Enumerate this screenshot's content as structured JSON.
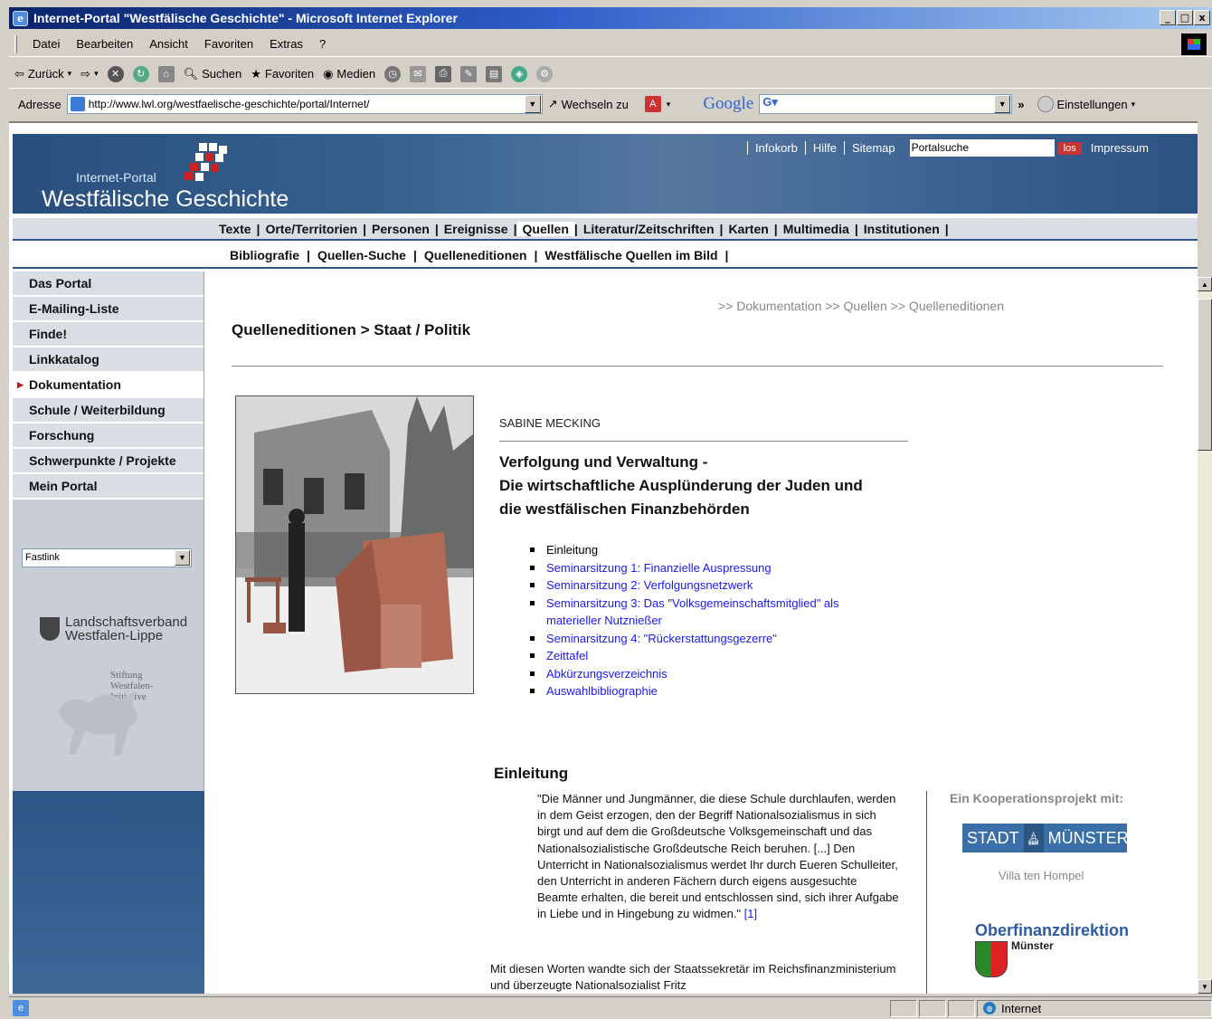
{
  "window": {
    "title": "Internet-Portal \"Westfälische Geschichte\" - Microsoft Internet Explorer",
    "controls": [
      "_",
      "□",
      "x"
    ]
  },
  "menu": [
    "Datei",
    "Bearbeiten",
    "Ansicht",
    "Favoriten",
    "Extras",
    "?"
  ],
  "toolbar": {
    "back": "Zurück",
    "search": "Suchen",
    "favorites": "Favoriten",
    "media": "Medien"
  },
  "address": {
    "label": "Adresse",
    "url": "http://www.lwl.org/westfaelische-geschichte/portal/Internet/",
    "go": "Wechseln zu",
    "google": "Google",
    "settings": "Einstellungen"
  },
  "header": {
    "subtitle": "Internet-Portal",
    "title": "Westfälische Geschichte",
    "links": [
      "Infokorb",
      "Hilfe",
      "Sitemap"
    ],
    "search_value": "Portalsuche",
    "search_button": "los",
    "impressum": "Impressum"
  },
  "nav1": [
    "Texte",
    "Orte/Territorien",
    "Personen",
    "Ereignisse",
    "Quellen",
    "Literatur/Zeitschriften",
    "Karten",
    "Multimedia",
    "Institutionen"
  ],
  "nav2": [
    "Bibliografie",
    "Quellen-Suche",
    "Quelleneditionen",
    "Westfälische Quellen im Bild"
  ],
  "sidebar": {
    "items": [
      "Das Portal",
      "E-Mailing-Liste",
      "Finde!",
      "Linkkatalog",
      "Dokumentation",
      "Schule / Weiterbildung",
      "Forschung",
      "Schwerpunkte / Projekte",
      "Mein Portal"
    ],
    "active_index": 4,
    "fastlink": "Fastlink",
    "brand_line1": "Landschaftsverband",
    "brand_line2": "Westfalen-Lippe",
    "stiftung": [
      "Stiftung",
      "Westfalen-",
      "Initiative"
    ]
  },
  "content": {
    "breadcrumb": ">> Dokumentation >> Quellen >> Quelleneditionen",
    "page_title": "Quelleneditionen > Staat / Politik",
    "author": "SABINE MECKING",
    "article_title": [
      "Verfolgung und Verwaltung -",
      "Die wirtschaftliche Ausplünderung der Juden und",
      "die westfälischen Finanzbehörden"
    ],
    "toc": [
      {
        "label": "Einleitung",
        "link": false
      },
      {
        "label": "Seminarsitzung 1: Finanzielle Auspressung",
        "link": true
      },
      {
        "label": "Seminarsitzung 2: Verfolgungsnetzwerk",
        "link": true
      },
      {
        "label": "Seminarsitzung 3: Das \"Volksgemeinschaftsmitglied\" als materieller Nutznießer",
        "link": true
      },
      {
        "label": "Seminarsitzung 4: \"Rückerstattungsgezerre\"",
        "link": true
      },
      {
        "label": "Zeittafel",
        "link": true
      },
      {
        "label": "Abkürzungsverzeichnis",
        "link": true
      },
      {
        "label": "Auswahlbibliographie",
        "link": true
      }
    ],
    "section_heading": "Einleitung",
    "quote": "\"Die Männer und Jungmänner, die diese Schule durchlaufen, werden in dem Geist erzogen, den der Begriff Nationalsozialismus in sich birgt und auf dem die Großdeutsche Volksgemeinschaft und das Nationalsozialistische Großdeutsche Reich beruhen. [...] Den Unterricht in Nationalsozialismus werdet Ihr durch Eueren Schulleiter, den Unterricht in anderen Fächern durch eigens ausgesuchte Beamte erhalten, die bereit und entschlossen sind, sich ihrer Aufgabe in Liebe und in Hingebung zu widmen.\"",
    "footnote": "[1]",
    "paragraph": "Mit diesen Worten wandte sich der Staatssekretär im Reichsfinanzministerium und überzeugte Nationalsozialist Fritz"
  },
  "partners": {
    "heading": "Ein Kooperationsprojekt mit:",
    "stadt_left": "STADT",
    "stadt_right": "MÜNSTER",
    "villa": "Villa ten Hompel",
    "ofd": "Oberfinanzdirektion",
    "ofd_sub": "Münster"
  },
  "status": {
    "zone": "Internet"
  },
  "colors": {
    "header_blue": "#2d5687",
    "nav_gray": "#d9dde4",
    "link_blue": "#1a1aee",
    "title_bar": "#0a246a"
  }
}
